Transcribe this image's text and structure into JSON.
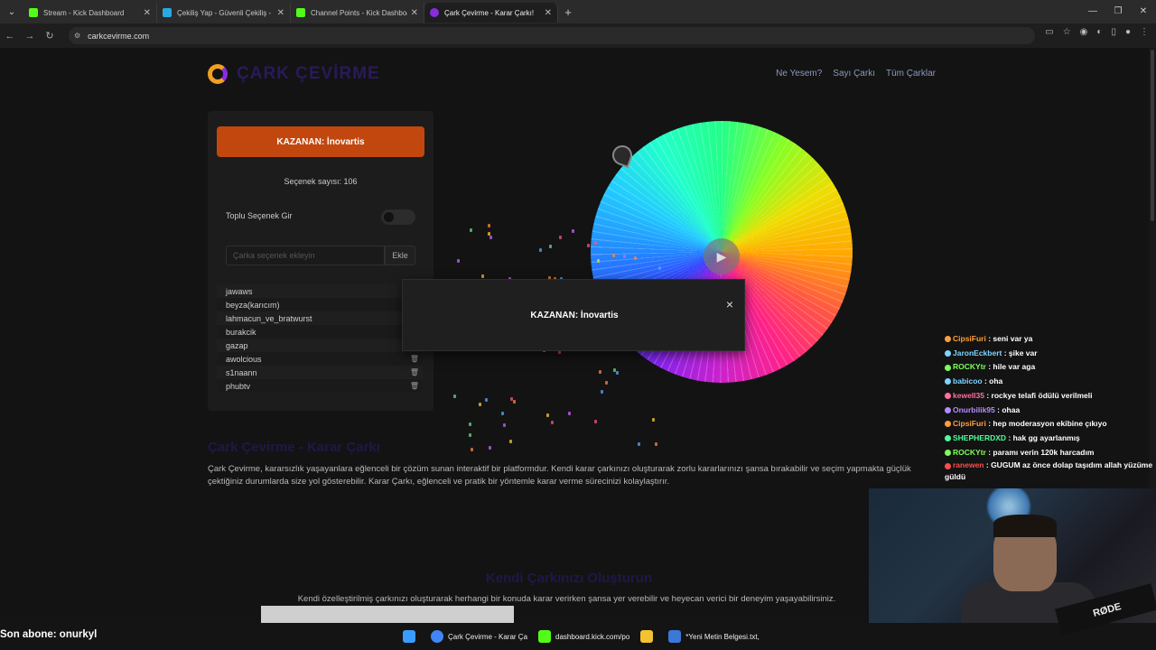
{
  "browser": {
    "tabs": [
      {
        "label": "Stream - Kick Dashboard",
        "color": "#53fc18",
        "active": false
      },
      {
        "label": "Çekiliş Yap - Güvenli Çekiliş - H",
        "color": "#2aa9e0",
        "active": false
      },
      {
        "label": "Channel Points - Kick Dashboar",
        "color": "#53fc18",
        "active": false
      },
      {
        "label": "Çark Çevirme - Karar Çarkı!",
        "color": "#8a2be2",
        "active": true
      }
    ],
    "url": "carkcevirme.com"
  },
  "site": {
    "logo_text": "ÇARK ÇEVİRME",
    "nav": [
      "Ne Yesem?",
      "Sayı Çarkı",
      "Tüm Çarklar"
    ]
  },
  "panel": {
    "winner_label": "KAZANAN: İnovartis",
    "count_label": "Seçenek sayısı: 106",
    "toggle_label": "Toplu Seçenek Gir",
    "input_placeholder": "Çarka seçenek ekleyin",
    "add_label": "Ekle",
    "options": [
      "jawaws",
      "beyza(karıcım)",
      "lahmacun_ve_bratwurst",
      "burakcik",
      "gazap",
      "awolcious",
      "s1naann",
      "phubtv"
    ]
  },
  "modal": {
    "text": "KAZANAN: İnovartis",
    "close": "×"
  },
  "content": {
    "heading1": "Çark Çevirme - Karar Çarkı",
    "paragraph1": "Çark Çevirme, kararsızlık yaşayanlara eğlenceli bir çözüm sunan interaktif bir platformdur. Kendi karar çarkınızı oluşturarak zorlu kararlarınızı şansa bırakabilir ve seçim yapmakta güçlük çektiğiniz durumlarda size yol gösterebilir. Karar Çarkı, eğlenceli ve pratik bir yöntemle karar verme sürecinizi kolaylaştırır.",
    "heading2": "Kendi Çarkınızı Oluşturun",
    "paragraph2": "Kendi özelleştirilmiş çarkınızı oluşturarak herhangi bir konuda karar verirken şansa yer verebilir ve heyecan verici bir deneyim yaşayabilirsiniz."
  },
  "chat": [
    {
      "user": "CipsiFuri",
      "color": "#ff9e3d",
      "msg": "seni var ya"
    },
    {
      "user": "JaronEckbert",
      "color": "#7fd4ff",
      "msg": "şike var"
    },
    {
      "user": "ROCKYtr",
      "color": "#7fff5a",
      "msg": "hile var aga"
    },
    {
      "user": "babicoo",
      "color": "#7fd4ff",
      "msg": "oha"
    },
    {
      "user": "kewell35",
      "color": "#ff6fa0",
      "msg": "rockye telafi ödülü verilmeli"
    },
    {
      "user": "Onurbilik95",
      "color": "#b48cff",
      "msg": "ohaa"
    },
    {
      "user": "CipsiFuri",
      "color": "#ff9e3d",
      "msg": "hep moderasyon ekibine çıkıyo"
    },
    {
      "user": "SHEPHERDXD",
      "color": "#4dff9a",
      "msg": "hak gg ayarlanmış"
    },
    {
      "user": "ROCKYtr",
      "color": "#7fff5a",
      "msg": "paramı verin 120k harcadım"
    },
    {
      "user": "ranewen",
      "color": "#ff4d4d",
      "msg": "GUGUM az önce dolap taşıdım allah yüzüme güldü"
    }
  ],
  "stream_overlay": {
    "last_sub": "Son abone: onurkyl",
    "mic_brand": "RØDE"
  },
  "taskbar": [
    {
      "label": "Çark Çevirme - Karar Ça",
      "color": "#4285f4"
    },
    {
      "label": "dashboard.kick.com/po",
      "color": "#53fc18"
    },
    {
      "label": "",
      "color": "#f2c230"
    },
    {
      "label": "*Yeni Metin Belgesi.txt, ",
      "color": "#3b78d8"
    }
  ]
}
